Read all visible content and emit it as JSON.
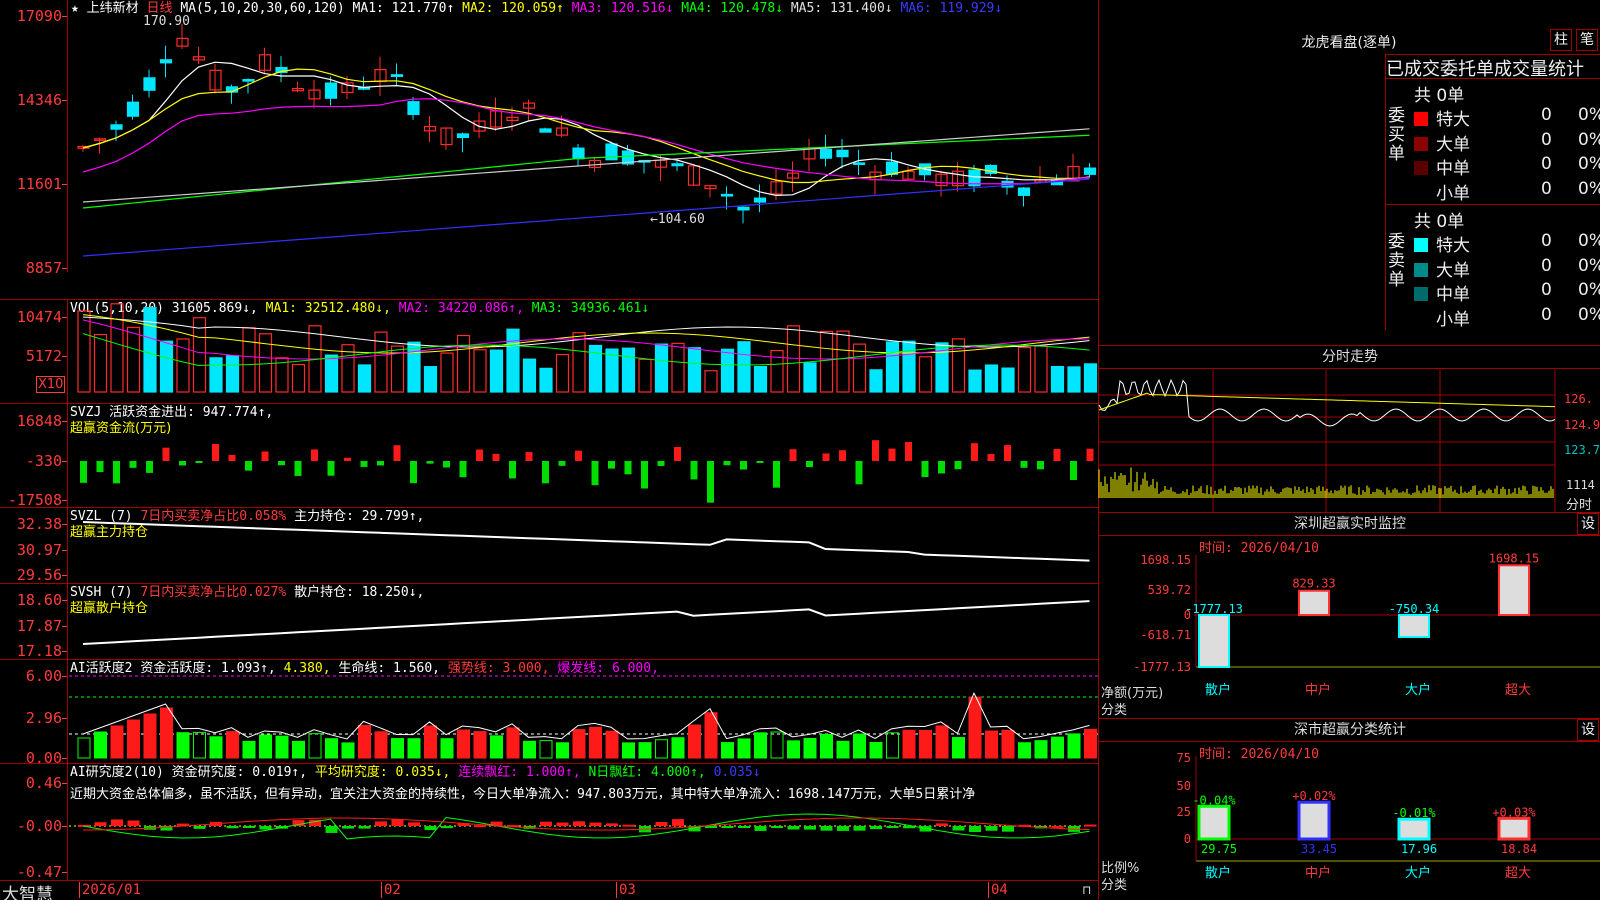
{
  "stock": {
    "name": "上纬新材",
    "period": "日线"
  },
  "main": {
    "ma_label": "MA(5,10,20,30,60,120)",
    "ma1": "MA1: 121.770↑",
    "ma2": "MA2: 120.059↑",
    "ma3": "MA3: 120.516↓",
    "ma4": "MA4: 120.478↓",
    "ma5": "MA5: 131.400↓",
    "ma6": "MA6: 119.929↓",
    "y": [
      "17090",
      "14346",
      "11601",
      "8857"
    ],
    "high_note": "170.90",
    "low_note": "←104.60"
  },
  "vol": {
    "label": "VOL(5,10,20)",
    "v": "31605.869↓,",
    "ma1": "MA1: 32512.480↓,",
    "ma2": "MA2: 34220.086↑,",
    "ma3": "MA3: 34936.461↓",
    "y": [
      "10474",
      "5172"
    ],
    "unit": "X10"
  },
  "svzj": {
    "label": "SVZJ",
    "desc": "活跃资金进出: 947.774↑,",
    "sub": "超赢资金流(万元)",
    "y": [
      "16848",
      "-330",
      "-17508"
    ]
  },
  "svzl": {
    "label": "SVZL (7)",
    "desc": "7日内买卖净占比0.058%",
    "val": "主力持仓: 29.799↑,",
    "sub": "超赢主力持仓",
    "y": [
      "32.38",
      "30.97",
      "29.56"
    ]
  },
  "svsh": {
    "label": "SVSH (7)",
    "desc": "7日内买卖净占比0.027%",
    "val": "散户持仓: 18.250↓,",
    "sub": "超赢散户持仓",
    "y": [
      "18.60",
      "17.87",
      "17.18"
    ]
  },
  "ai1": {
    "label": "AI活跃度2",
    "a": "资金活跃度: 1.093↑,",
    "b": "4.380,",
    "c": "生命线: 1.560,",
    "d": "强势线: 3.000,",
    "e": "爆发线: 6.000,",
    "y": [
      "6.00",
      "2.96",
      "0.00"
    ]
  },
  "ai2": {
    "label": "AI研究度2(10)",
    "a": "资金研究度: 0.019↑,",
    "b": "平均研究度: 0.035↓,",
    "c": "连续飘红: 1.000↑,",
    "d": "N日飘红: 4.000↑,",
    "e": "0.035↓",
    "note": "近期大资金总体偏多，虽不活跃，但有异动，宜关注大资金的持续性，今日大单净流入：947.803万元，其中特大单净流入：1698.147万元，大单5日累计净",
    "y": [
      "0.46",
      "-0.00",
      "-0.47"
    ]
  },
  "xaxis": [
    "2026/01",
    "02",
    "03",
    "04"
  ],
  "brand": "大智慧",
  "right": {
    "lh_title": "龙虎看盘(逐单)",
    "btn1": "柱",
    "btn2": "笔",
    "tabs": "已成交委托单成交量统计",
    "buy": {
      "side": "委买单",
      "total": "共 0单",
      "rows": [
        {
          "k": "特大",
          "v": "0",
          "p": "0%",
          "c": "#ff0000"
        },
        {
          "k": "大单",
          "v": "0",
          "p": "0%",
          "c": "#8b0000"
        },
        {
          "k": "中单",
          "v": "0",
          "p": "0%",
          "c": "#5a0000"
        },
        {
          "k": "小单",
          "v": "0",
          "p": "0%",
          "c": ""
        }
      ]
    },
    "sell": {
      "side": "委卖单",
      "total": "共 0单",
      "rows": [
        {
          "k": "特大",
          "v": "0",
          "p": "0%",
          "c": "#00ffff"
        },
        {
          "k": "大单",
          "v": "0",
          "p": "0%",
          "c": "#008b8b"
        },
        {
          "k": "中单",
          "v": "0",
          "p": "0%",
          "c": "#006b6b"
        },
        {
          "k": "小单",
          "v": "0",
          "p": "0%",
          "c": ""
        }
      ]
    },
    "fs_title": "分时走势",
    "fs_y": [
      "126.",
      "124.9",
      "123.7"
    ],
    "fs_vol": "1114",
    "fs_unit": "分时",
    "sz_title": "深圳超赢实时监控",
    "sz_btn": "设",
    "sz_time": "时间: 2026/04/10",
    "sz_y": [
      "1698.15",
      "539.72",
      "0",
      "-618.71",
      "-1777.13"
    ],
    "sz_unit": "净额(万元)",
    "sz_cls": "分类",
    "sz_bars": [
      {
        "k": "散户",
        "v": -1777.13,
        "t": "-1777.13"
      },
      {
        "k": "中户",
        "v": 829.33,
        "t": "829.33"
      },
      {
        "k": "大户",
        "v": -750.34,
        "t": "-750.34"
      },
      {
        "k": "超大",
        "v": 1698.15,
        "t": "1698.15"
      }
    ],
    "st_title": "深市超赢分类统计",
    "st_btn": "设",
    "st_time": "时间: 2026/04/10",
    "st_y": [
      "75",
      "50",
      "25",
      "0"
    ],
    "st_unit": "比例%",
    "st_cls": "分类",
    "st_bars": [
      {
        "k": "散户",
        "v": 29.75,
        "t": "29.75",
        "d": "-0.04%"
      },
      {
        "k": "中户",
        "v": 33.45,
        "t": "33.45",
        "d": "+0.02%"
      },
      {
        "k": "大户",
        "v": 17.96,
        "t": "17.96",
        "d": "-0.01%"
      },
      {
        "k": "超大",
        "v": 18.84,
        "t": "18.84",
        "d": "+0.03%"
      }
    ]
  }
}
